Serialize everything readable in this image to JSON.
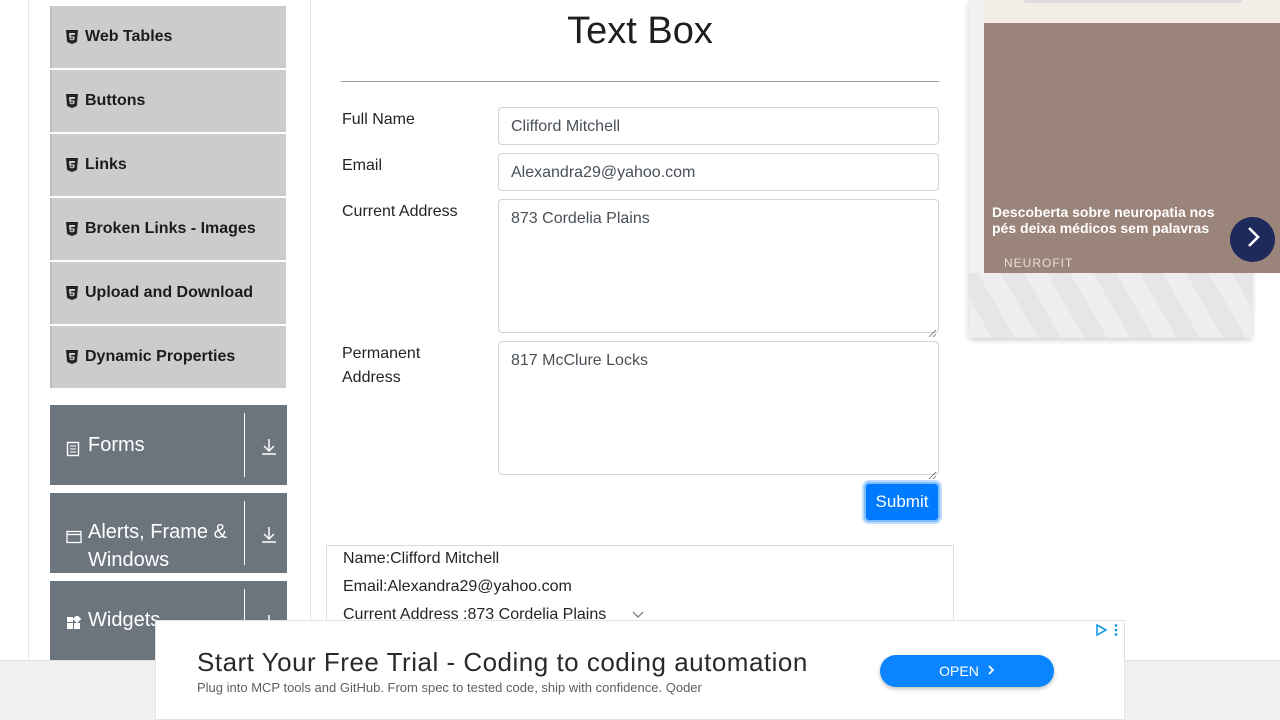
{
  "sidebar": {
    "sub_items": [
      {
        "label": "Web Tables"
      },
      {
        "label": "Buttons"
      },
      {
        "label": "Links"
      },
      {
        "label": "Broken Links - Images"
      },
      {
        "label": "Upload and Download"
      },
      {
        "label": "Dynamic Properties"
      }
    ],
    "groups": [
      {
        "label": "Forms",
        "icon": "document-icon"
      },
      {
        "label": "Alerts, Frame &",
        "label2": "Windows",
        "icon": "window-icon"
      },
      {
        "label": "Widgets",
        "icon": "widgets-icon"
      }
    ]
  },
  "main": {
    "title": "Text Box",
    "fields": {
      "full_name_label": "Full Name",
      "full_name_value": "Clifford Mitchell",
      "email_label": "Email",
      "email_value": "Alexandra29@yahoo.com",
      "current_address_label": "Current Address",
      "current_address_value": "873 Cordelia Plains",
      "permanent_address_label_1": "Permanent",
      "permanent_address_label_2": "Address",
      "permanent_address_value": "817 McClure Locks"
    },
    "submit_label": "Submit",
    "output": {
      "name": "Name:Clifford Mitchell",
      "email": "Email:Alexandra29@yahoo.com",
      "current_address": "Current Address :873 Cordelia Plains"
    }
  },
  "side_ad": {
    "headline": "Descoberta sobre neuropatia nos pés deixa médicos sem palavras",
    "brand": "NEUROFIT"
  },
  "bottom_ad": {
    "headline": "Start Your Free Trial - Coding to coding automation",
    "subtext": "Plug into MCP tools and GitHub. From spec to tested code, ship with confidence. Qoder",
    "open_label": "OPEN"
  },
  "colors": {
    "accent": "#007bff",
    "sidebar_group": "#6c757d",
    "sidebar_item": "#cccccc"
  }
}
